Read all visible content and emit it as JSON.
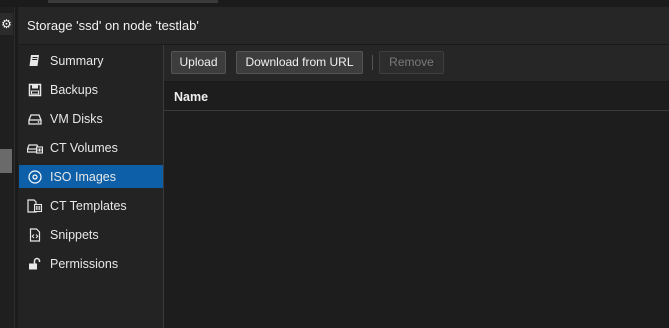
{
  "header": {
    "title": "Storage 'ssd' on node 'testlab'"
  },
  "sidebar": {
    "items": [
      {
        "label": "Summary",
        "icon": "book-icon",
        "active": false
      },
      {
        "label": "Backups",
        "icon": "floppy-icon",
        "active": false
      },
      {
        "label": "VM Disks",
        "icon": "hdd-icon",
        "active": false
      },
      {
        "label": "CT Volumes",
        "icon": "ct-volume-icon",
        "active": false
      },
      {
        "label": "ISO Images",
        "icon": "disc-icon",
        "active": true
      },
      {
        "label": "CT Templates",
        "icon": "ct-template-icon",
        "active": false
      },
      {
        "label": "Snippets",
        "icon": "snippet-file-icon",
        "active": false
      },
      {
        "label": "Permissions",
        "icon": "unlock-icon",
        "active": false
      }
    ]
  },
  "toolbar": {
    "upload_label": "Upload",
    "download_label": "Download from URL",
    "remove_label": "Remove"
  },
  "grid": {
    "columns": [
      "Name"
    ],
    "rows": []
  },
  "colors": {
    "accent": "#0d5fa8",
    "background": "#1d1d1d",
    "panel": "#232323"
  }
}
